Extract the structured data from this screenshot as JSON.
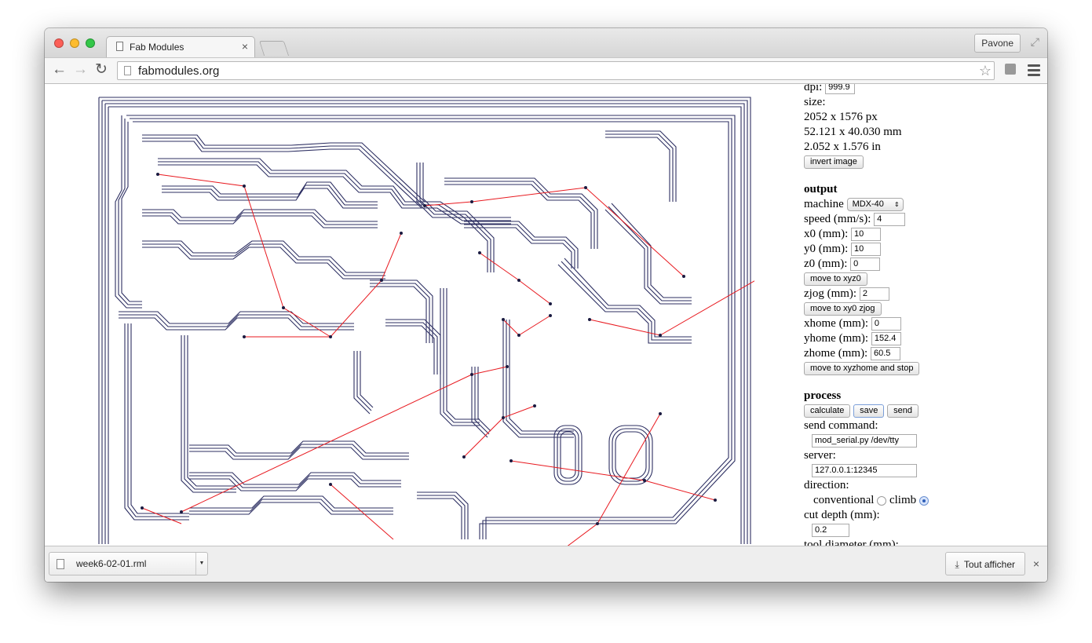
{
  "browser": {
    "tab_title": "Fab Modules",
    "tab_close": "×",
    "user": "Pavone",
    "url": "fabmodules.org"
  },
  "panel": {
    "dpi_label": "dpi:",
    "dpi_value": "999.9",
    "size_label": "size:",
    "size_px": "2052 x 1576 px",
    "size_mm": "52.121 x 40.030 mm",
    "size_in": "2.052 x 1.576 in",
    "invert_button": "invert image",
    "output_heading": "output",
    "machine_label": "machine",
    "machine_value": "MDX-40",
    "speed_label": "speed (mm/s):",
    "speed_value": "4",
    "x0_label": "x0 (mm):",
    "x0_value": "10",
    "y0_label": "y0 (mm):",
    "y0_value": "10",
    "z0_label": "z0 (mm):",
    "z0_value": "0",
    "move_xyz0_button": "move to xyz0",
    "zjog_label": "zjog (mm):",
    "zjog_value": "2",
    "move_xy0_zjog_button": "move to xy0 zjog",
    "xhome_label": "xhome (mm):",
    "xhome_value": "0",
    "yhome_label": "yhome (mm):",
    "yhome_value": "152.4",
    "zhome_label": "zhome (mm):",
    "zhome_value": "60.5",
    "move_home_button": "move to xyzhome and stop",
    "process_heading": "process",
    "calculate_button": "calculate",
    "save_button": "save",
    "send_button": "send",
    "send_command_label": "send command:",
    "send_command_value": "mod_serial.py /dev/tty",
    "server_label": "server:",
    "server_value": "127.0.0.1:12345",
    "direction_label": "direction:",
    "conventional_label": "conventional",
    "climb_label": "climb",
    "cut_depth_label": "cut depth (mm):",
    "cut_depth_value": "0.2",
    "tool_diameter_label": "tool diameter (mm):"
  },
  "downloads": {
    "file_name": "week6-02-01.rml",
    "show_all": "Tout afficher",
    "close": "×"
  },
  "colors": {
    "toolpath": "#2d2f62",
    "jump_lines": "#e8191f",
    "nodes": "#1a1a40"
  }
}
